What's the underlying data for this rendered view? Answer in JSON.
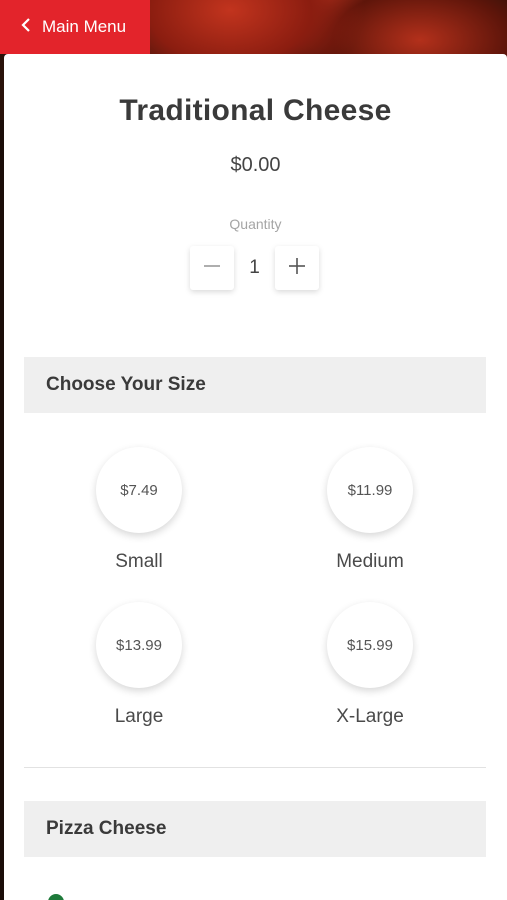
{
  "nav": {
    "back_label": "Main Menu"
  },
  "item": {
    "title": "Traditional Cheese",
    "price": "$0.00"
  },
  "quantity": {
    "label": "Quantity",
    "value": "1"
  },
  "sections": {
    "size": {
      "title": "Choose Your Size",
      "options": [
        {
          "price": "$7.49",
          "name": "Small"
        },
        {
          "price": "$11.99",
          "name": "Medium"
        },
        {
          "price": "$13.99",
          "name": "Large"
        },
        {
          "price": "$15.99",
          "name": "X-Large"
        }
      ]
    },
    "cheese": {
      "title": "Pizza Cheese"
    }
  },
  "colors": {
    "accent": "#e3242b",
    "section_bg": "#efefef",
    "radio": "#1e7a3a"
  },
  "icons": {
    "back": "chevron-left-icon",
    "minus": "minus-icon",
    "plus": "plus-icon"
  }
}
